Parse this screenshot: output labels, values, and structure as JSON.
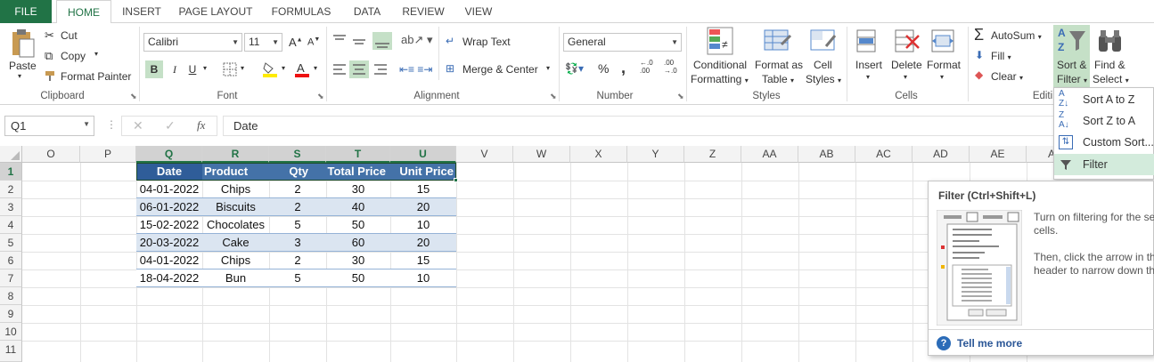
{
  "tabs": [
    {
      "label": "FILE"
    },
    {
      "label": "HOME"
    },
    {
      "label": "INSERT"
    },
    {
      "label": "PAGE LAYOUT"
    },
    {
      "label": "FORMULAS"
    },
    {
      "label": "DATA"
    },
    {
      "label": "REVIEW"
    },
    {
      "label": "VIEW"
    }
  ],
  "clipboard": {
    "paste": "Paste",
    "cut": "Cut",
    "copy": "Copy",
    "format_painter": "Format Painter",
    "group": "Clipboard"
  },
  "font": {
    "name": "Calibri",
    "size": "11",
    "bold": "B",
    "italic": "I",
    "underline": "U",
    "group": "Font"
  },
  "alignment": {
    "wrap": "Wrap Text",
    "merge": "Merge & Center",
    "group": "Alignment"
  },
  "number": {
    "format": "General",
    "percent": "%",
    "comma": ",",
    "group": "Number"
  },
  "styles": {
    "conditional": "Conditional",
    "conditional2": "Formatting",
    "format_table": "Format as",
    "format_table2": "Table",
    "cell_styles": "Cell",
    "cell_styles2": "Styles",
    "group": "Styles"
  },
  "cells": {
    "insert": "Insert",
    "delete": "Delete",
    "format": "Format",
    "group": "Cells"
  },
  "editing": {
    "autosum": "AutoSum",
    "fill": "Fill",
    "clear": "Clear",
    "sort": "Sort &",
    "sort2": "Filter",
    "find": "Find &",
    "find2": "Select",
    "group": "Editi"
  },
  "formula_bar": {
    "name_box": "Q1",
    "fx": "fx",
    "value": "Date"
  },
  "columns": [
    "O",
    "P",
    "Q",
    "R",
    "S",
    "T",
    "U",
    "V",
    "W",
    "X",
    "Y",
    "Z",
    "AA",
    "AB",
    "AC",
    "AD",
    "AE",
    "A"
  ],
  "rows": [
    "1",
    "2",
    "3",
    "4",
    "5",
    "6",
    "7",
    "8",
    "9",
    "10",
    "11"
  ],
  "table": {
    "headers": [
      "Date",
      "Product",
      "Qty",
      "Total Price",
      "Unit Price"
    ],
    "rows": [
      [
        "04-01-2022",
        "Chips",
        "2",
        "30",
        "15"
      ],
      [
        "06-01-2022",
        "Biscuits",
        "2",
        "40",
        "20"
      ],
      [
        "15-02-2022",
        "Chocolates",
        "5",
        "50",
        "10"
      ],
      [
        "20-03-2022",
        "Cake",
        "3",
        "60",
        "20"
      ],
      [
        "04-01-2022",
        "Chips",
        "2",
        "30",
        "15"
      ],
      [
        "18-04-2022",
        "Bun",
        "5",
        "50",
        "10"
      ]
    ]
  },
  "sort_menu": {
    "items": [
      {
        "label": "Sort A to Z"
      },
      {
        "label": "Sort Z to A"
      },
      {
        "label": "Custom Sort..."
      },
      {
        "label": "Filter"
      }
    ]
  },
  "tooltip": {
    "title": "Filter (Ctrl+Shift+L)",
    "desc1": "Turn on filtering for the se",
    "desc2": "cells.",
    "desc3": "Then, click the arrow in th",
    "desc4": "header to narrow down th",
    "more": "Tell me more"
  },
  "colors": {
    "accent": "#217346",
    "table_header": "#4472a8",
    "band": "#dbe5f1",
    "menu_active": "#d3ebdc"
  }
}
